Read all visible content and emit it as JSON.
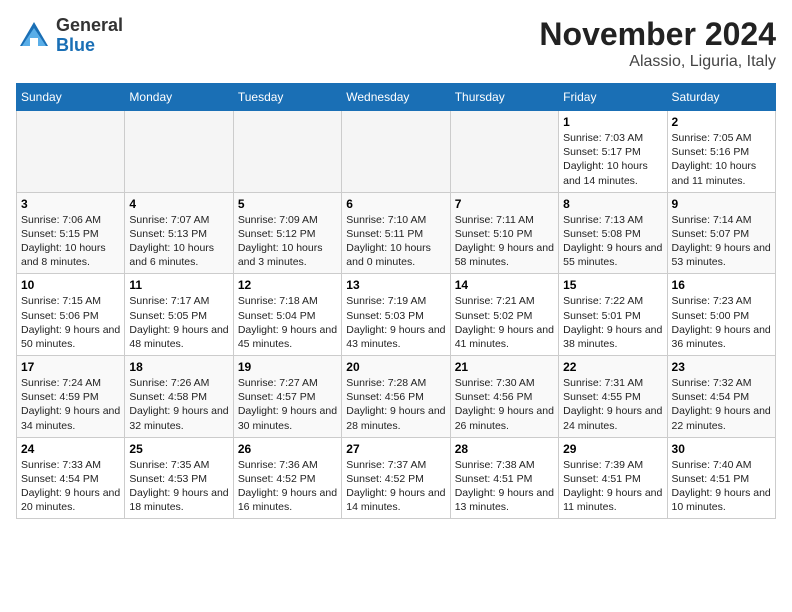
{
  "header": {
    "logo_general": "General",
    "logo_blue": "Blue",
    "month_title": "November 2024",
    "location": "Alassio, Liguria, Italy"
  },
  "days_of_week": [
    "Sunday",
    "Monday",
    "Tuesday",
    "Wednesday",
    "Thursday",
    "Friday",
    "Saturday"
  ],
  "weeks": [
    [
      {
        "day": "",
        "info": ""
      },
      {
        "day": "",
        "info": ""
      },
      {
        "day": "",
        "info": ""
      },
      {
        "day": "",
        "info": ""
      },
      {
        "day": "",
        "info": ""
      },
      {
        "day": "1",
        "info": "Sunrise: 7:03 AM\nSunset: 5:17 PM\nDaylight: 10 hours and 14 minutes."
      },
      {
        "day": "2",
        "info": "Sunrise: 7:05 AM\nSunset: 5:16 PM\nDaylight: 10 hours and 11 minutes."
      }
    ],
    [
      {
        "day": "3",
        "info": "Sunrise: 7:06 AM\nSunset: 5:15 PM\nDaylight: 10 hours and 8 minutes."
      },
      {
        "day": "4",
        "info": "Sunrise: 7:07 AM\nSunset: 5:13 PM\nDaylight: 10 hours and 6 minutes."
      },
      {
        "day": "5",
        "info": "Sunrise: 7:09 AM\nSunset: 5:12 PM\nDaylight: 10 hours and 3 minutes."
      },
      {
        "day": "6",
        "info": "Sunrise: 7:10 AM\nSunset: 5:11 PM\nDaylight: 10 hours and 0 minutes."
      },
      {
        "day": "7",
        "info": "Sunrise: 7:11 AM\nSunset: 5:10 PM\nDaylight: 9 hours and 58 minutes."
      },
      {
        "day": "8",
        "info": "Sunrise: 7:13 AM\nSunset: 5:08 PM\nDaylight: 9 hours and 55 minutes."
      },
      {
        "day": "9",
        "info": "Sunrise: 7:14 AM\nSunset: 5:07 PM\nDaylight: 9 hours and 53 minutes."
      }
    ],
    [
      {
        "day": "10",
        "info": "Sunrise: 7:15 AM\nSunset: 5:06 PM\nDaylight: 9 hours and 50 minutes."
      },
      {
        "day": "11",
        "info": "Sunrise: 7:17 AM\nSunset: 5:05 PM\nDaylight: 9 hours and 48 minutes."
      },
      {
        "day": "12",
        "info": "Sunrise: 7:18 AM\nSunset: 5:04 PM\nDaylight: 9 hours and 45 minutes."
      },
      {
        "day": "13",
        "info": "Sunrise: 7:19 AM\nSunset: 5:03 PM\nDaylight: 9 hours and 43 minutes."
      },
      {
        "day": "14",
        "info": "Sunrise: 7:21 AM\nSunset: 5:02 PM\nDaylight: 9 hours and 41 minutes."
      },
      {
        "day": "15",
        "info": "Sunrise: 7:22 AM\nSunset: 5:01 PM\nDaylight: 9 hours and 38 minutes."
      },
      {
        "day": "16",
        "info": "Sunrise: 7:23 AM\nSunset: 5:00 PM\nDaylight: 9 hours and 36 minutes."
      }
    ],
    [
      {
        "day": "17",
        "info": "Sunrise: 7:24 AM\nSunset: 4:59 PM\nDaylight: 9 hours and 34 minutes."
      },
      {
        "day": "18",
        "info": "Sunrise: 7:26 AM\nSunset: 4:58 PM\nDaylight: 9 hours and 32 minutes."
      },
      {
        "day": "19",
        "info": "Sunrise: 7:27 AM\nSunset: 4:57 PM\nDaylight: 9 hours and 30 minutes."
      },
      {
        "day": "20",
        "info": "Sunrise: 7:28 AM\nSunset: 4:56 PM\nDaylight: 9 hours and 28 minutes."
      },
      {
        "day": "21",
        "info": "Sunrise: 7:30 AM\nSunset: 4:56 PM\nDaylight: 9 hours and 26 minutes."
      },
      {
        "day": "22",
        "info": "Sunrise: 7:31 AM\nSunset: 4:55 PM\nDaylight: 9 hours and 24 minutes."
      },
      {
        "day": "23",
        "info": "Sunrise: 7:32 AM\nSunset: 4:54 PM\nDaylight: 9 hours and 22 minutes."
      }
    ],
    [
      {
        "day": "24",
        "info": "Sunrise: 7:33 AM\nSunset: 4:54 PM\nDaylight: 9 hours and 20 minutes."
      },
      {
        "day": "25",
        "info": "Sunrise: 7:35 AM\nSunset: 4:53 PM\nDaylight: 9 hours and 18 minutes."
      },
      {
        "day": "26",
        "info": "Sunrise: 7:36 AM\nSunset: 4:52 PM\nDaylight: 9 hours and 16 minutes."
      },
      {
        "day": "27",
        "info": "Sunrise: 7:37 AM\nSunset: 4:52 PM\nDaylight: 9 hours and 14 minutes."
      },
      {
        "day": "28",
        "info": "Sunrise: 7:38 AM\nSunset: 4:51 PM\nDaylight: 9 hours and 13 minutes."
      },
      {
        "day": "29",
        "info": "Sunrise: 7:39 AM\nSunset: 4:51 PM\nDaylight: 9 hours and 11 minutes."
      },
      {
        "day": "30",
        "info": "Sunrise: 7:40 AM\nSunset: 4:51 PM\nDaylight: 9 hours and 10 minutes."
      }
    ]
  ]
}
